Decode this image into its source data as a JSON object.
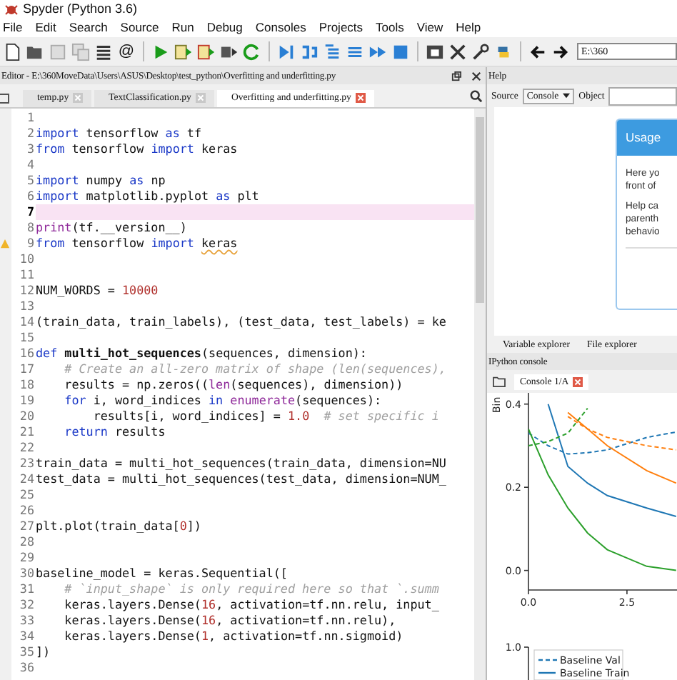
{
  "window": {
    "title": "Spyder (Python 3.6)"
  },
  "menu": [
    "File",
    "Edit",
    "Search",
    "Source",
    "Run",
    "Debug",
    "Consoles",
    "Projects",
    "Tools",
    "View",
    "Help"
  ],
  "toolbar": {
    "at_sign": "@",
    "path": "E:\\360"
  },
  "editor": {
    "title": "Editor - E:\\360MoveData\\Users\\ASUS\\Desktop\\test_python\\Overfitting and underfitting.py",
    "tabs": [
      {
        "label": "temp.py",
        "selected": false
      },
      {
        "label": "TextClassification.py",
        "selected": false
      },
      {
        "label": "Overfitting and underfitting.py",
        "selected": true
      }
    ],
    "lines": [
      {
        "number": "1",
        "current": false,
        "warning": false
      },
      {
        "number": "2",
        "current": false,
        "warning": false,
        "tokens": [
          {
            "text": "import",
            "kind": "kw"
          },
          {
            "text": " tensorflow ",
            "kind": "plain"
          },
          {
            "text": "as",
            "kind": "kw"
          },
          {
            "text": " tf",
            "kind": "plain"
          }
        ]
      },
      {
        "number": "3",
        "current": false,
        "warning": false,
        "tokens": [
          {
            "text": "from",
            "kind": "kw"
          },
          {
            "text": " tensorflow ",
            "kind": "plain"
          },
          {
            "text": "import",
            "kind": "kw"
          },
          {
            "text": " keras",
            "kind": "plain"
          }
        ]
      },
      {
        "number": "4",
        "current": false,
        "warning": false
      },
      {
        "number": "5",
        "current": false,
        "warning": false,
        "tokens": [
          {
            "text": "import",
            "kind": "kw"
          },
          {
            "text": " numpy ",
            "kind": "plain"
          },
          {
            "text": "as",
            "kind": "kw"
          },
          {
            "text": " np",
            "kind": "plain"
          }
        ]
      },
      {
        "number": "6",
        "current": false,
        "warning": false,
        "tokens": [
          {
            "text": "import",
            "kind": "kw"
          },
          {
            "text": " matplotlib.pyplot ",
            "kind": "plain"
          },
          {
            "text": "as",
            "kind": "kw"
          },
          {
            "text": " plt",
            "kind": "plain"
          }
        ]
      },
      {
        "number": "7",
        "current": true,
        "warning": false
      },
      {
        "number": "8",
        "current": false,
        "warning": false,
        "tokens": [
          {
            "text": "print",
            "kind": "builtin"
          },
          {
            "text": "(tf.__version__)",
            "kind": "plain"
          }
        ]
      },
      {
        "number": "9",
        "current": false,
        "warning": true,
        "tokens": [
          {
            "text": "from",
            "kind": "kw"
          },
          {
            "text": " tensorflow ",
            "kind": "plain"
          },
          {
            "text": "import ",
            "kind": "kw"
          },
          {
            "text": "keras",
            "kind": "flagged"
          }
        ]
      },
      {
        "number": "10",
        "current": false,
        "warning": false
      },
      {
        "number": "11",
        "current": false,
        "warning": false
      },
      {
        "number": "12",
        "current": false,
        "warning": false,
        "tokens": [
          {
            "text": "NUM_WORDS = ",
            "kind": "plain"
          },
          {
            "text": "10000",
            "kind": "num"
          }
        ]
      },
      {
        "number": "13",
        "current": false,
        "warning": false
      },
      {
        "number": "14",
        "current": false,
        "warning": false,
        "tokens": [
          {
            "text": "(train_data, train_labels), (test_data, test_labels) = ke",
            "kind": "plain"
          }
        ]
      },
      {
        "number": "15",
        "current": false,
        "warning": false
      },
      {
        "number": "16",
        "current": false,
        "warning": false,
        "tokens": [
          {
            "text": "def ",
            "kind": "kw"
          },
          {
            "text": "multi_hot_sequences",
            "kind": "defname"
          },
          {
            "text": "(sequences, dimension):",
            "kind": "plain"
          }
        ]
      },
      {
        "number": "17",
        "current": false,
        "warning": false,
        "tokens": [
          {
            "text": "    # Create an all-zero matrix of shape (len(sequences),",
            "kind": "comment"
          }
        ]
      },
      {
        "number": "18",
        "current": false,
        "warning": false,
        "tokens": [
          {
            "text": "    results = np.zeros((",
            "kind": "plain"
          },
          {
            "text": "len",
            "kind": "builtin"
          },
          {
            "text": "(sequences), dimension))",
            "kind": "plain"
          }
        ]
      },
      {
        "number": "19",
        "current": false,
        "warning": false,
        "tokens": [
          {
            "text": "    for",
            "kind": "kw"
          },
          {
            "text": " i, word_indices ",
            "kind": "plain"
          },
          {
            "text": "in ",
            "kind": "kw"
          },
          {
            "text": "enumerate",
            "kind": "builtin"
          },
          {
            "text": "(sequences):",
            "kind": "plain"
          }
        ]
      },
      {
        "number": "20",
        "current": false,
        "warning": false,
        "tokens": [
          {
            "text": "        results[i, word_indices] = ",
            "kind": "plain"
          },
          {
            "text": "1.0",
            "kind": "num"
          },
          {
            "text": "  # set specific i",
            "kind": "comment"
          }
        ]
      },
      {
        "number": "21",
        "current": false,
        "warning": false,
        "tokens": [
          {
            "text": "    return",
            "kind": "kw"
          },
          {
            "text": " results",
            "kind": "plain"
          }
        ]
      },
      {
        "number": "22",
        "current": false,
        "warning": false
      },
      {
        "number": "23",
        "current": false,
        "warning": false,
        "tokens": [
          {
            "text": "train_data = multi_hot_sequences(train_data, dimension=NU",
            "kind": "plain"
          }
        ]
      },
      {
        "number": "24",
        "current": false,
        "warning": false,
        "tokens": [
          {
            "text": "test_data = multi_hot_sequences(test_data, dimension=NUM_",
            "kind": "plain"
          }
        ]
      },
      {
        "number": "25",
        "current": false,
        "warning": false
      },
      {
        "number": "26",
        "current": false,
        "warning": false
      },
      {
        "number": "27",
        "current": false,
        "warning": false,
        "tokens": [
          {
            "text": "plt.plot(train_data[",
            "kind": "plain"
          },
          {
            "text": "0",
            "kind": "num"
          },
          {
            "text": "])",
            "kind": "plain"
          }
        ]
      },
      {
        "number": "28",
        "current": false,
        "warning": false
      },
      {
        "number": "29",
        "current": false,
        "warning": false
      },
      {
        "number": "30",
        "current": false,
        "warning": false,
        "tokens": [
          {
            "text": "baseline_model = keras.Sequential([",
            "kind": "plain"
          }
        ]
      },
      {
        "number": "31",
        "current": false,
        "warning": false,
        "tokens": [
          {
            "text": "    # `input_shape` is only required here so that `.summ",
            "kind": "comment"
          }
        ]
      },
      {
        "number": "32",
        "current": false,
        "warning": false,
        "tokens": [
          {
            "text": "    keras.layers.Dense(",
            "kind": "plain"
          },
          {
            "text": "16",
            "kind": "num"
          },
          {
            "text": ", activation=tf.nn.relu, input_",
            "kind": "plain"
          }
        ]
      },
      {
        "number": "33",
        "current": false,
        "warning": false,
        "tokens": [
          {
            "text": "    keras.layers.Dense(",
            "kind": "plain"
          },
          {
            "text": "16",
            "kind": "num"
          },
          {
            "text": ", activation=tf.nn.relu),",
            "kind": "plain"
          }
        ]
      },
      {
        "number": "34",
        "current": false,
        "warning": false,
        "tokens": [
          {
            "text": "    keras.layers.Dense(",
            "kind": "plain"
          },
          {
            "text": "1",
            "kind": "num"
          },
          {
            "text": ", activation=tf.nn.sigmoid)",
            "kind": "plain"
          }
        ]
      },
      {
        "number": "35",
        "current": false,
        "warning": false,
        "tokens": [
          {
            "text": "])",
            "kind": "plain"
          }
        ]
      },
      {
        "number": "36",
        "current": false,
        "warning": false
      }
    ]
  },
  "help": {
    "title": "Help",
    "source_label": "Source",
    "source_value": "Console",
    "object_label": "Object",
    "usage": {
      "heading": "Usage",
      "paragraphs": [
        [
          "Here yo",
          "front of"
        ],
        [
          "Help ca",
          "parenth",
          "behavio"
        ]
      ]
    }
  },
  "explorer_tabs": [
    {
      "label": "Variable explorer",
      "selected": false
    },
    {
      "label": "File explorer",
      "selected": false
    }
  ],
  "console": {
    "title": "IPython console",
    "tabs": [
      {
        "label": "Console 1/A",
        "selected": true
      }
    ],
    "chart_data": {
      "type": "line",
      "ylabel": "Bin",
      "x": [
        0,
        0.5,
        1,
        1.5,
        2,
        3,
        3.75
      ],
      "xlim": [
        0,
        3.77
      ],
      "ylim": [
        -0.047,
        0.427
      ],
      "xticks": [
        {
          "value": 0,
          "label": "0.0"
        },
        {
          "value": 2.5,
          "label": "2.5"
        }
      ],
      "yticks": [
        {
          "value": 0,
          "label": "0.0"
        },
        {
          "value": 0.2,
          "label": "0.2"
        },
        {
          "value": 0.4,
          "label": "0.4"
        }
      ],
      "series": [
        {
          "color": "#1f77b4",
          "line_style": "dashed",
          "values": [
            0.33,
            0.3,
            0.28,
            0.283,
            0.29,
            0.32,
            0.333
          ]
        },
        {
          "color": "#1f77b4",
          "line_style": "solid",
          "values": [
            null,
            0.4,
            0.25,
            0.21,
            0.18,
            0.15,
            0.13
          ]
        },
        {
          "color": "#ff7f0e",
          "line_style": "dashed",
          "values": [
            null,
            null,
            0.37,
            0.34,
            0.32,
            0.3,
            0.29
          ]
        },
        {
          "color": "#ff7f0e",
          "line_style": "solid",
          "values": [
            null,
            null,
            0.38,
            0.34,
            0.3,
            0.24,
            0.21
          ]
        },
        {
          "color": "#2ca02c",
          "line_style": "dashed",
          "values": [
            0.3,
            0.31,
            0.33,
            0.39,
            null,
            null,
            null
          ]
        },
        {
          "color": "#2ca02c",
          "line_style": "solid",
          "values": [
            0.34,
            0.23,
            0.15,
            0.09,
            0.05,
            0.01,
            0.0
          ]
        }
      ]
    },
    "lower_plot": {
      "ytick": "1.0",
      "legend": [
        {
          "label": "Baseline Val",
          "color": "#1f77b4",
          "dashed": true
        },
        {
          "label": "Baseline Train",
          "color": "#1f77b4",
          "dashed": false
        }
      ]
    }
  }
}
